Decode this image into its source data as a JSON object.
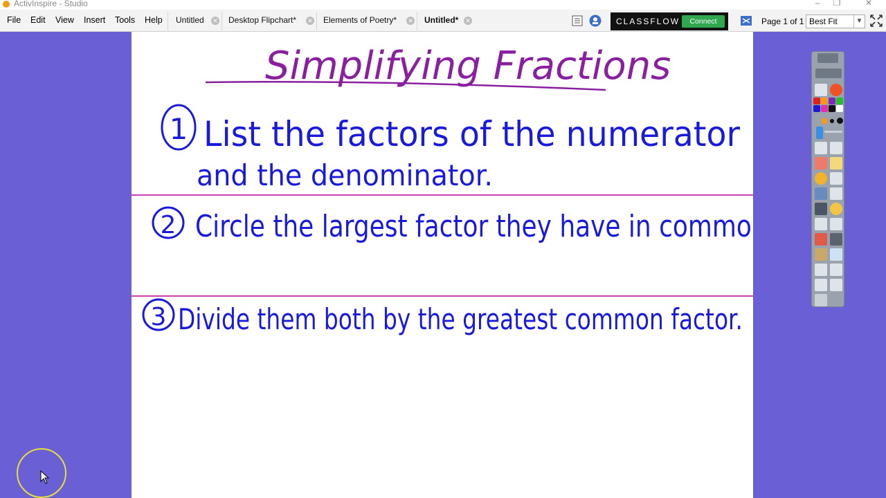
{
  "window": {
    "title": "ActivInspire - Studio",
    "controls": [
      "–",
      "❐",
      "✕"
    ]
  },
  "menu": [
    "File",
    "Edit",
    "View",
    "Insert",
    "Tools",
    "Help"
  ],
  "tabs": [
    {
      "label": "Untitled",
      "active": false
    },
    {
      "label": "Desktop Flipchart*",
      "active": false
    },
    {
      "label": "Elements of Poetry*",
      "active": false
    },
    {
      "label": "Untitled*",
      "active": true
    }
  ],
  "classflow": {
    "label": "CLASSFLOW",
    "connect": "Connect"
  },
  "page_indicator": "Page 1 of 1",
  "zoom": "Best Fit",
  "flipchart": {
    "title": "Simplifying Fractions",
    "steps": [
      {
        "number": "1",
        "line1": "List  the factors of the numerator",
        "line2": "and the denominator."
      },
      {
        "number": "2",
        "line1": "Circle the largest factor they have in common."
      },
      {
        "number": "3",
        "line1": "Divide them both by the greatest common factor."
      }
    ],
    "ink_color": "#1a1adb",
    "title_color": "#8a1fa0",
    "divider_color": "#cc3fb0"
  },
  "toolbox": {
    "palette": [
      "#e02020",
      "#f29a1a",
      "#2a3fd1",
      "#25c02a",
      "#1a1adb",
      "#e02fa8",
      "#111111",
      "#ffffff"
    ]
  }
}
